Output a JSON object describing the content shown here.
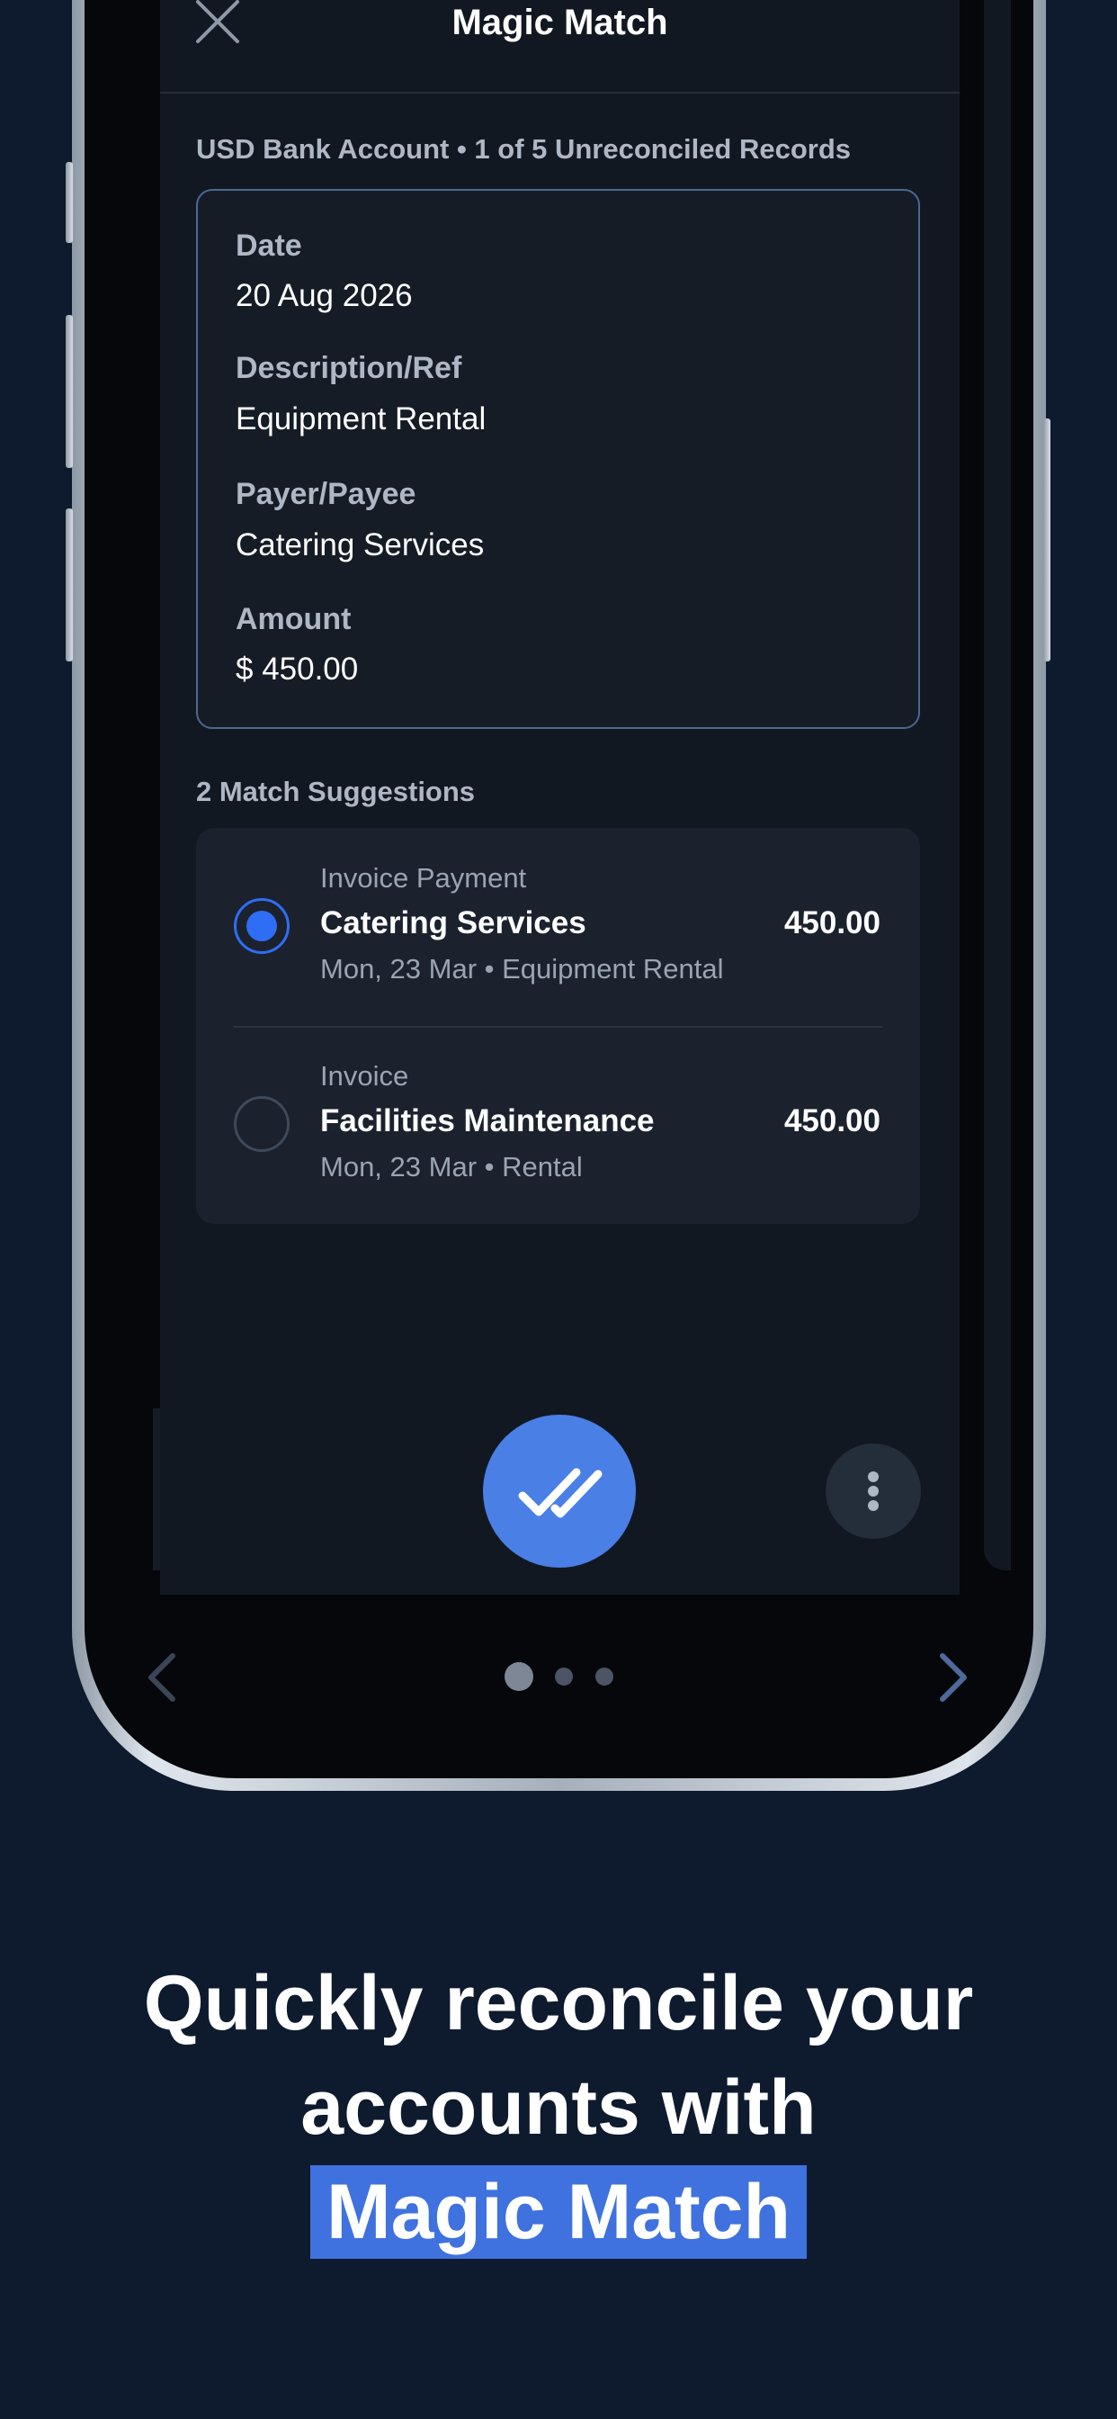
{
  "header": {
    "title": "Magic Match",
    "close_icon": "close-icon"
  },
  "record": {
    "account_line": "USD Bank Account • 1 of 5 Unreconciled Records",
    "fields": [
      {
        "label": "Date",
        "value": "20 Aug 2026"
      },
      {
        "label": "Description/Ref",
        "value": "Equipment Rental"
      },
      {
        "label": "Payer/Payee",
        "value": "Catering Services"
      },
      {
        "label": "Amount",
        "value": "$ 450.00"
      }
    ]
  },
  "suggestions": {
    "title": "2 Match Suggestions",
    "items": [
      {
        "type": "Invoice Payment",
        "name": "Catering Services",
        "amount": "450.00",
        "meta": "Mon, 23 Mar • Equipment Rental",
        "selected": true
      },
      {
        "type": "Invoice",
        "name": "Facilities Maintenance",
        "amount": "450.00",
        "meta": "Mon, 23 Mar • Rental",
        "selected": false
      }
    ]
  },
  "actions": {
    "confirm_icon": "double-check-icon",
    "more_icon": "more-vertical-icon"
  },
  "pager": {
    "prev_icon": "chevron-left-icon",
    "next_icon": "chevron-right-icon",
    "pages": 3,
    "current_page": 1
  },
  "headline": {
    "line1": "Quickly reconcile your",
    "line2": "accounts with",
    "highlight": "Magic Match"
  },
  "colors": {
    "background": "#0e1a2e",
    "accent": "#4a7fe6",
    "radio_selected": "#2f6df5",
    "highlight": "#3f72df"
  }
}
